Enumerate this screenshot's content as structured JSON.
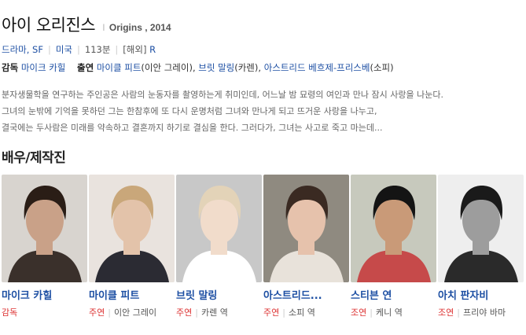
{
  "movie": {
    "title": "아이 오리진스",
    "sep": "I",
    "original_title": "Origins , 2014"
  },
  "meta": {
    "genre": "드라마, SF",
    "country": "미국",
    "runtime": "113분",
    "overseas": "[해외]",
    "rating": "R"
  },
  "credits": {
    "director_label": "감독",
    "director": "마이크 카힐",
    "cast_label": "출연",
    "cast": [
      {
        "name": "마이클 피트",
        "role": "(이안 그레이)"
      },
      {
        "name": "브릿 말링",
        "role": "(카렌)"
      },
      {
        "name": "아스트리드 베흐제-프리스베",
        "role": "(소피)"
      }
    ]
  },
  "synopsis": [
    "분자생물학을 연구하는 주인공은 사람의 눈동자를 촬영하는게 취미인데, 어느날 밤 묘령의 여인과 만나 잠시 사랑을 나눈다.",
    "그녀의 눈밖에 기억을 못하던 그는 한참후에 또 다시 운명처럼 그녀와 만나게 되고 뜨거운 사랑을 나누고,",
    "결국에는 두사람은 미래를 약속하고 결혼까지 하기로 결심을 한다. 그러다가, 그녀는 사고로 죽고 마는데..."
  ],
  "section_title": "배우/제작진",
  "people": [
    {
      "name": "마이크 카힐",
      "role": "감독",
      "character": "",
      "colors": {
        "bg": "#d8d4cf",
        "hair": "#2a1d16",
        "skin": "#c9a188",
        "shirt": "#3a302b"
      }
    },
    {
      "name": "마이클 피트",
      "role": "주연",
      "character": "이안 그레이",
      "colors": {
        "bg": "#e9e3de",
        "hair": "#c9a77a",
        "skin": "#e3c3aa",
        "shirt": "#2b2b33"
      }
    },
    {
      "name": "브릿 말링",
      "role": "주연",
      "character": "카렌 역",
      "colors": {
        "bg": "#c8c8c8",
        "hair": "#e3d3b8",
        "skin": "#f1dccb",
        "shirt": "#ffffff"
      }
    },
    {
      "name": "아스트리드...",
      "role": "주연",
      "character": "소피 역",
      "colors": {
        "bg": "#8f8a80",
        "hair": "#3a2a22",
        "skin": "#e6c2ac",
        "shirt": "#e8e2da"
      }
    },
    {
      "name": "스티븐 연",
      "role": "조연",
      "character": "케니 역",
      "colors": {
        "bg": "#c7c9bd",
        "hair": "#141414",
        "skin": "#c99a78",
        "shirt": "#c64a4a"
      }
    },
    {
      "name": "아치 판자비",
      "role": "조연",
      "character": "프리야 바마",
      "colors": {
        "bg": "#eeeeee",
        "hair": "#1a1a1a",
        "skin": "#9d9d9d",
        "shirt": "#2a2a2a"
      }
    }
  ]
}
